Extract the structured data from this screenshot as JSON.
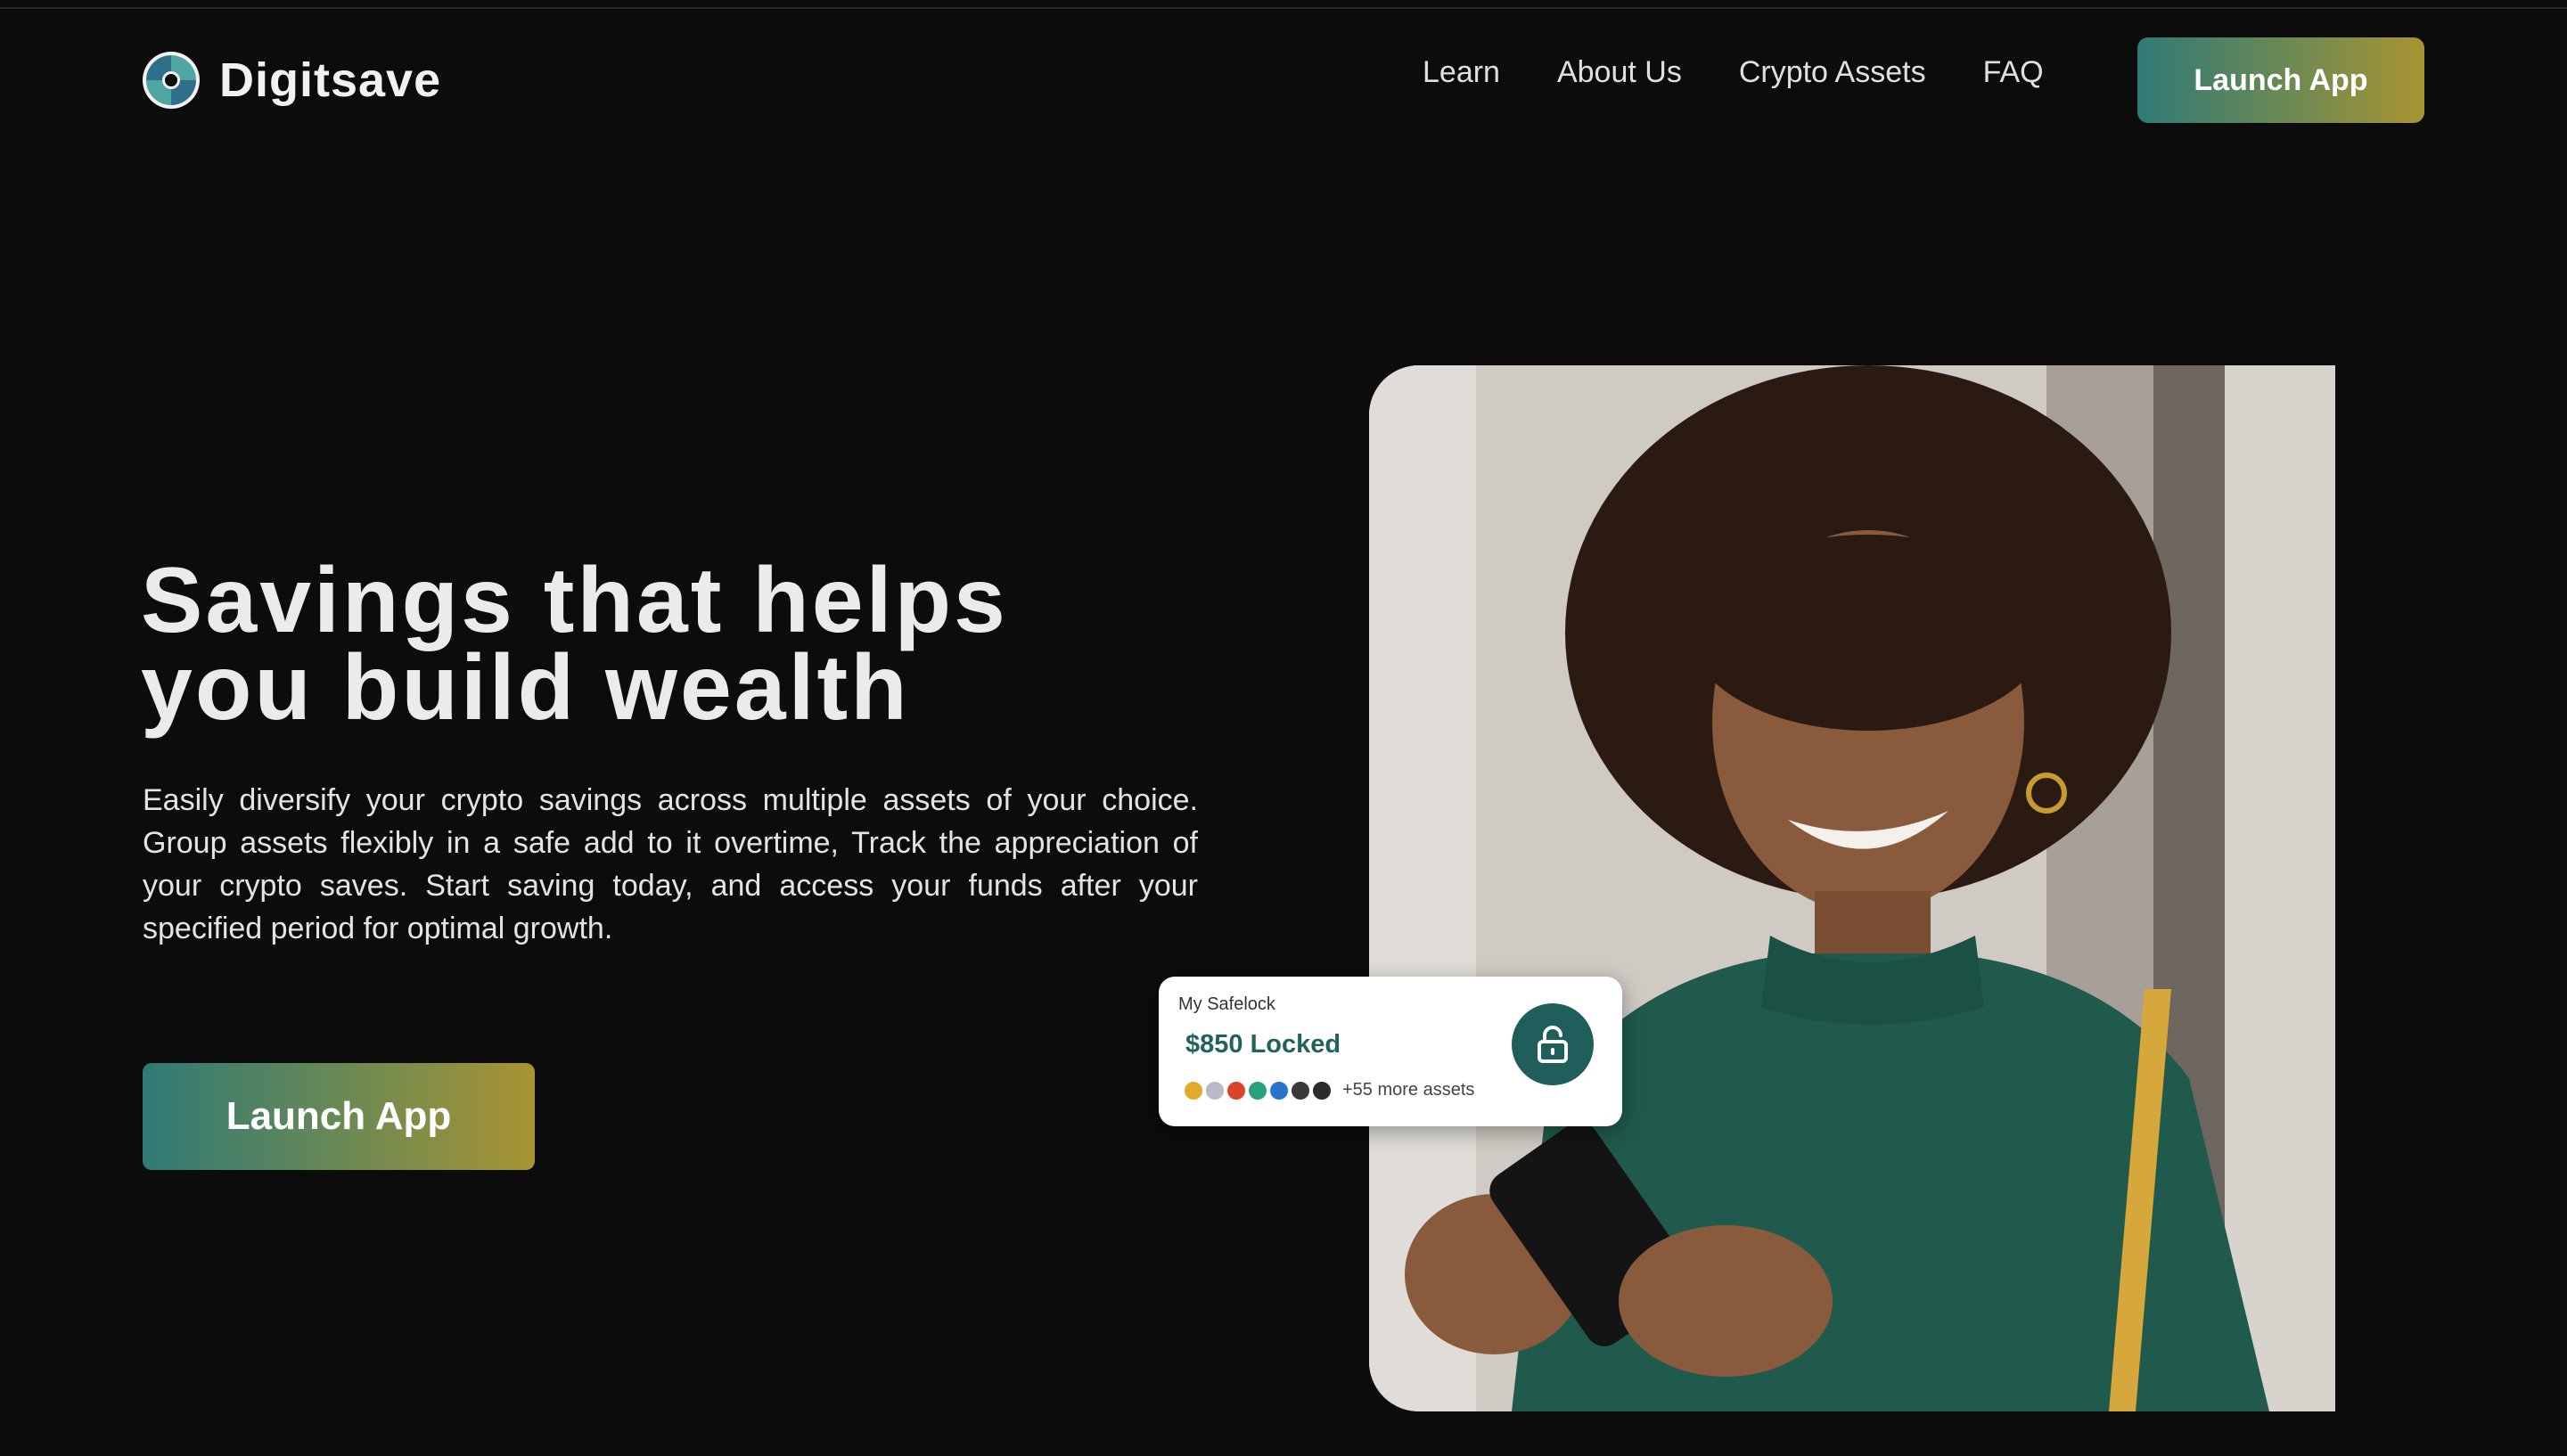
{
  "brand": {
    "name": "Digitsave",
    "accent_teal": "#2f7a76",
    "accent_gold": "#a89433",
    "background": "#0c0c0c"
  },
  "nav": {
    "links": [
      "Learn",
      "About Us",
      "Crypto Assets",
      "FAQ"
    ],
    "cta_label": "Launch App"
  },
  "hero": {
    "title_line1": "Savings that helps",
    "title_line2": "you build wealth",
    "description": "Easily diversify your crypto savings across multiple assets of your choice. Group assets flexibly in a safe add to it overtime, Track the appreciation of your crypto saves. Start saving today, and access your funds after your specified period for optimal growth.",
    "cta_label": "Launch App"
  },
  "safelock_card": {
    "label": "My Safelock",
    "amount": "$850 Locked",
    "more_assets": "+55 more assets",
    "coin_colors": [
      "#e3a92b",
      "#b9b9c9",
      "#d9452b",
      "#26a17b",
      "#2775ca",
      "#3a3a3a",
      "#2b2b2b"
    ],
    "icon": "unlock-icon"
  },
  "photo": {
    "icon": "woman-with-phone-image"
  }
}
